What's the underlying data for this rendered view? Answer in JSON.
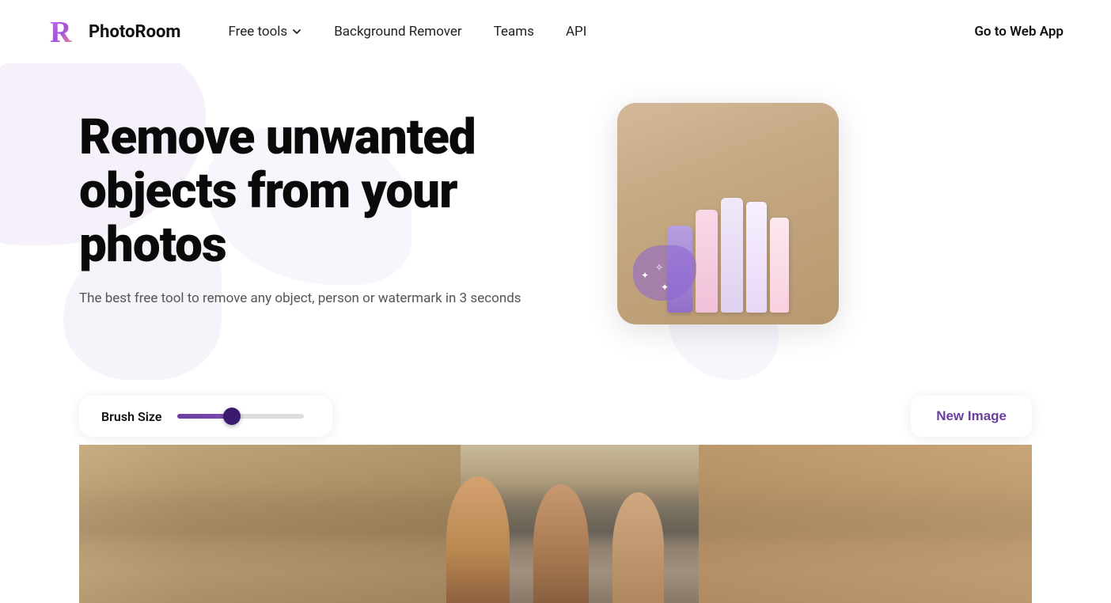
{
  "nav": {
    "logo_text": "PhotoRoom",
    "links": [
      {
        "id": "free-tools",
        "label": "Free tools",
        "has_dropdown": true
      },
      {
        "id": "background-remover",
        "label": "Background Remover"
      },
      {
        "id": "teams",
        "label": "Teams"
      },
      {
        "id": "api",
        "label": "API"
      }
    ],
    "cta": "Go to Web App"
  },
  "hero": {
    "title": "Remove unwanted objects from your photos",
    "subtitle": "The best free tool to remove any object, person or watermark in 3 seconds"
  },
  "tool": {
    "brush_label": "Brush Size",
    "new_image_label": "New Image",
    "slider_value": 45
  }
}
